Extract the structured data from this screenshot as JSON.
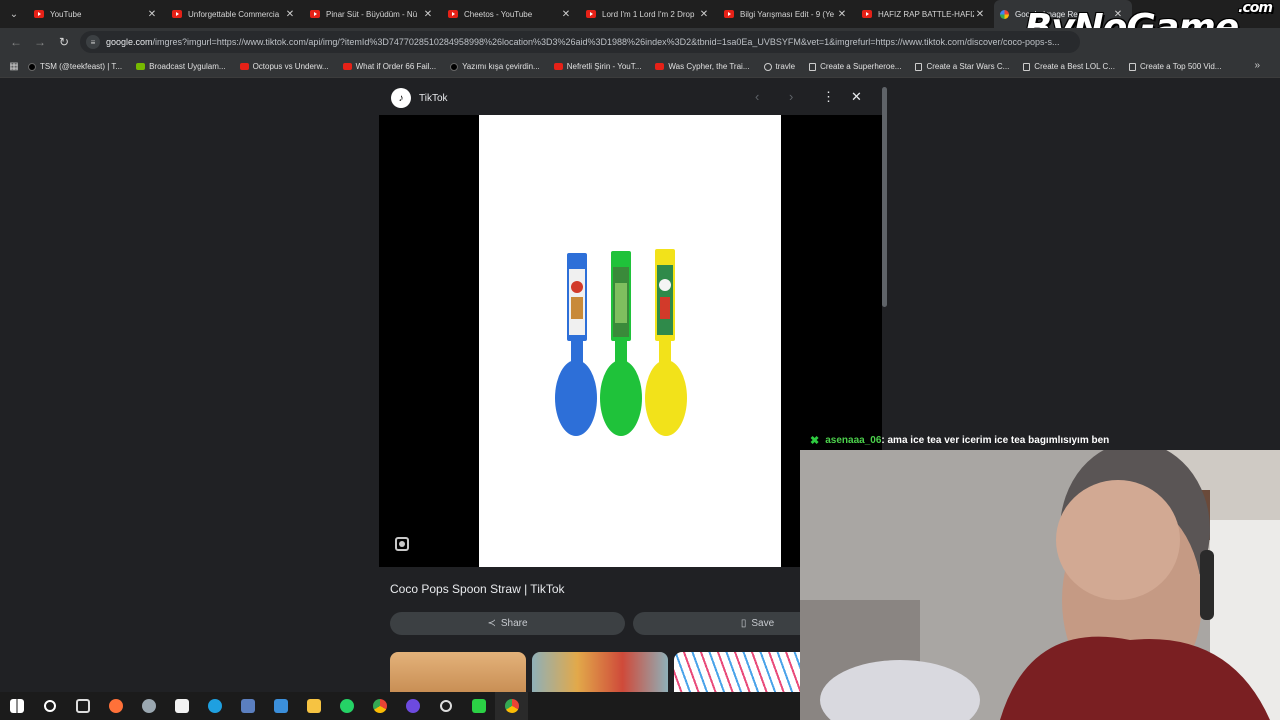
{
  "tabs": [
    {
      "label": "YouTube",
      "icon": "youtube-icon",
      "active": false
    },
    {
      "label": "Unforgettable Commercia",
      "icon": "youtube-icon",
      "active": false
    },
    {
      "label": "Pinar Süt - Büyüdüm - Nü",
      "icon": "youtube-icon",
      "active": false
    },
    {
      "label": "Cheetos - YouTube",
      "icon": "youtube-icon",
      "active": false
    },
    {
      "label": "Lord I'm 1 Lord I'm 2 Drop",
      "icon": "youtube-icon",
      "active": false
    },
    {
      "label": "Bilgi Yarışması Edit - 9 (Ye",
      "icon": "youtube-icon",
      "active": false
    },
    {
      "label": "HAFIZ RAP BATTLE-HAFIZ",
      "icon": "youtube-icon",
      "active": false
    },
    {
      "label": "Google Image Res",
      "icon": "google-icon",
      "active": true
    }
  ],
  "watermark": {
    "text": "ByNoGame",
    "suffix": ".com"
  },
  "address": {
    "host": "google.com",
    "path": "/imgres?imgurl=https://www.tiktok.com/api/img/?itemId%3D7477028510284958998%26location%3D3%26aid%3D1988%26index%3D2&tbnid=1sa0Ea_UVBSYFM&vet=1&imgrefurl=https://www.tiktok.com/discover/coco-pops-s..."
  },
  "bookmarks": [
    {
      "label": "TSM (@teekfeast) | T...",
      "icon": "tt"
    },
    {
      "label": "Broadcast Uygulam...",
      "icon": "nv"
    },
    {
      "label": "Octopus vs Underw...",
      "icon": "yt"
    },
    {
      "label": "What if Order 66 Fail...",
      "icon": "yt"
    },
    {
      "label": "Yazımı kışa çevirdin...",
      "icon": "tt"
    },
    {
      "label": "Nefretli Şirin - YouT...",
      "icon": "yt"
    },
    {
      "label": "Was Cypher, the Trai...",
      "icon": "yt"
    },
    {
      "label": "travle",
      "icon": "cp"
    },
    {
      "label": "Create a Superheroe...",
      "icon": "pg"
    },
    {
      "label": "Create a Star Wars C...",
      "icon": "pg"
    },
    {
      "label": "Create a Best LOL C...",
      "icon": "pg"
    },
    {
      "label": "Create a Top 500 Vid...",
      "icon": "pg"
    }
  ],
  "viewer": {
    "site_name": "TikTok",
    "image_title": "Coco Pops Spoon Straw | TikTok",
    "share_label": "Share",
    "save_label": "Save"
  },
  "chat": {
    "username": "asenaaa_06",
    "message": ": ama ice tea ver icerim ice tea bagımlısıyım ben"
  },
  "colors": {
    "spoon_blue": "#2d6fd8",
    "spoon_green": "#1fc23a",
    "spoon_yellow": "#f2e21a",
    "chat_user": "#4cd14c"
  }
}
